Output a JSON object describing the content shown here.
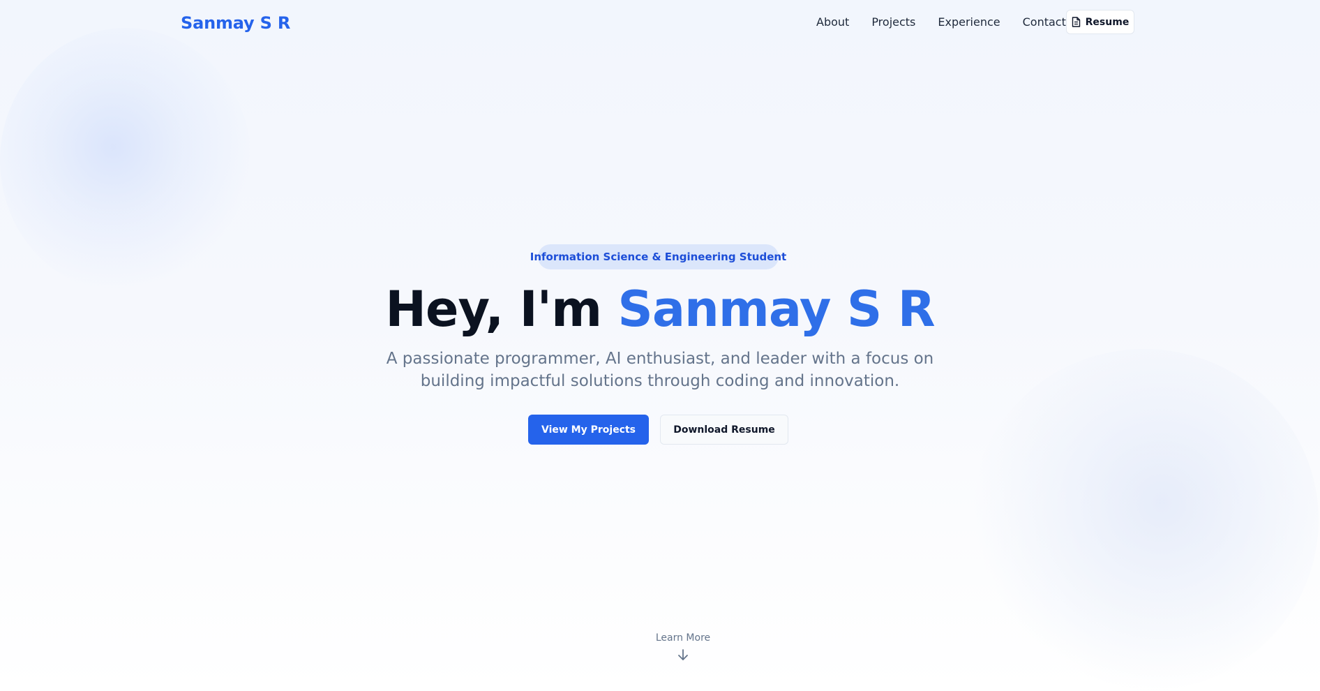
{
  "header": {
    "logo": "Sanmay S R",
    "nav": [
      "About",
      "Projects",
      "Experience",
      "Contact"
    ],
    "resume_button": {
      "label": "Resume",
      "icon": "document-icon"
    }
  },
  "hero": {
    "badge": "Information Science & Engineering Student",
    "title_prefix": "Hey, I'm ",
    "title_name": "Sanmay S R",
    "subtitle": "A passionate programmer, AI enthusiast, and leader with a focus on building impactful solutions through coding and innovation.",
    "primary_button": "View My Projects",
    "secondary_button": "Download Resume"
  },
  "learn_more": {
    "label": "Learn More",
    "icon": "arrow-down-icon"
  },
  "colors": {
    "accent": "#2563eb",
    "accent_text": "#2f6fe8",
    "badge_bg": "#dbe6fb",
    "muted_text": "#64748b",
    "heading_text": "#0b1220"
  }
}
